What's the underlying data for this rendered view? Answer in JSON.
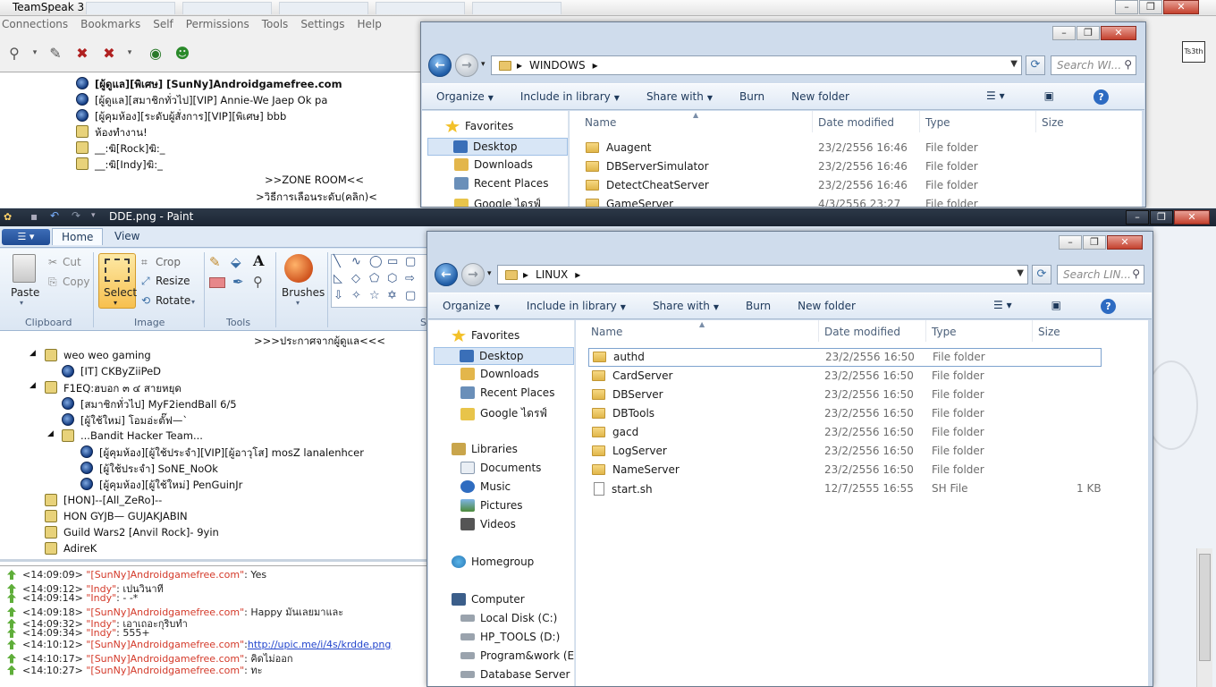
{
  "teamspeak": {
    "title": "TeamSpeak 3",
    "menu": [
      "Connections",
      "Bookmarks",
      "Self",
      "Permissions",
      "Tools",
      "Settings",
      "Help"
    ],
    "tree_top": [
      {
        "text": "[ผู้ดูแล][พิเศษ] [SunNy]Androidgamefree.com",
        "kind": "user",
        "bold": true
      },
      {
        "text": "[ผู้ดูแล][สมาชิกทั่วไป][VIP] Annie-We Jaep Ok pa",
        "kind": "user"
      },
      {
        "text": "[ผู้คุมห้อง][ระดับผู้สั่งการ][VIP][พิเศษ] bbb",
        "kind": "user"
      },
      {
        "text": "ห้องทำงาน!",
        "kind": "chan"
      },
      {
        "text": "__:ฆิ[Rock]ฆิ:_",
        "kind": "chan"
      },
      {
        "text": "__:ฆิ[Indy]ฆิ:_",
        "kind": "chan"
      }
    ],
    "zone_room": ">>ZONE ROOM<<",
    "choose_level": ">วิธีการเลือนระดับ(คลิก)<",
    "avatar_text": "Ts3th",
    "announcement": ">>>ประกาศจากผู้ดูแล<<<",
    "tree_bottom": [
      {
        "text": "weo weo gaming",
        "kind": "chan",
        "indent": 1
      },
      {
        "text": "[IT] CKByZiiPeD",
        "kind": "user",
        "indent": 2
      },
      {
        "text": "F1EQ:ฮบอก ๓ ๔ สายหยุด",
        "kind": "chan",
        "indent": 1
      },
      {
        "text": "[สมาชิกทั่วไป] MyF2iendBall 6/5",
        "kind": "user",
        "indent": 2
      },
      {
        "text": "[ผู้ใช้ใหม่] โอมอ่ะตั๊ฟ—`",
        "kind": "user",
        "indent": 2
      },
      {
        "text": "...Bandit Hacker Team...",
        "kind": "chan",
        "indent": 2
      },
      {
        "text": "[ผู้คุมห้อง][ผู้ใช้ประจำ][VIP][ผู้อาวุโส] mosZ lanalenhcer",
        "kind": "user",
        "indent": 3
      },
      {
        "text": "[ผู้ใช้ประจำ] SoNE_NoOk",
        "kind": "user",
        "indent": 3
      },
      {
        "text": "[ผู้คุมห้อง][ผู้ใช้ใหม่] PenGuinJr",
        "kind": "user",
        "indent": 3
      },
      {
        "text": "[HON]--[All_ZeRo]--",
        "kind": "chan",
        "indent": 1
      },
      {
        "text": "HON GYJB— GUJAKJABIN",
        "kind": "chan",
        "indent": 1
      },
      {
        "text": "Guild Wars2 [Anvil Rock]-  9yin",
        "kind": "chan",
        "indent": 1
      },
      {
        "text": "AdireK",
        "kind": "chan",
        "indent": 1
      }
    ],
    "log": [
      {
        "time": "<14:09:09>",
        "user": "\"[SunNy]Androidgamefree.com\"",
        "msg": ": Yes"
      },
      {
        "time": "<14:09:12>",
        "user": "\"Indy\"",
        "msg": ": เปนวินาที"
      },
      {
        "time": "<14:09:14>",
        "user": "\"Indy\"",
        "msg": ":  - -*"
      },
      {
        "time": "<14:09:18>",
        "user": "\"[SunNy]Androidgamefree.com\"",
        "msg": ": Happy  มันเลยมาและ"
      },
      {
        "time": "<14:09:32>",
        "user": "\"Indy\"",
        "msg": ": เอาเถอะกุริบทำ"
      },
      {
        "time": "<14:09:34>",
        "user": "\"Indy\"",
        "msg": ": 555+"
      },
      {
        "time": "<14:10:12>",
        "user": "\"[SunNy]Androidgamefree.com\"",
        "msg": ": ",
        "link": "http://upic.me/i/4s/krdde.png"
      },
      {
        "time": "<14:10:17>",
        "user": "\"[SunNy]Androidgamefree.com\"",
        "msg": ": คิดไม่ออก"
      },
      {
        "time": "<14:10:27>",
        "user": "\"[SunNy]Androidgamefree.com\"",
        "msg": ": ทะ"
      }
    ]
  },
  "paint": {
    "title": "DDE.png - Paint",
    "tabs": {
      "home": "Home",
      "view": "View"
    },
    "clipboard": {
      "paste": "Paste",
      "cut": "Cut",
      "copy": "Copy",
      "label": "Clipboard"
    },
    "image": {
      "select": "Select",
      "crop": "Crop",
      "resize": "Resize",
      "rotate": "Rotate",
      "label": "Image"
    },
    "tools_label": "Tools",
    "brushes": "Brushes",
    "shapes_label_clip": "S"
  },
  "explorer_windows": {
    "path": "WINDOWS",
    "search_placeholder": "Search WI...",
    "commands": [
      "Organize",
      "Include in library",
      "Share with",
      "Burn",
      "New folder"
    ],
    "columns": {
      "name": "Name",
      "date": "Date modified",
      "type": "Type",
      "size": "Size"
    },
    "nav": [
      {
        "label": "Favorites",
        "icon": "star-icon"
      },
      {
        "label": "Desktop",
        "icon": "desktop-icon",
        "selected": true
      },
      {
        "label": "Downloads",
        "icon": "downloads-icon"
      },
      {
        "label": "Recent Places",
        "icon": "recent-icon"
      },
      {
        "label": "Google ไดรฟ์",
        "icon": "drive-icon"
      }
    ],
    "files": [
      {
        "name": "Auagent",
        "date": "23/2/2556 16:46",
        "type": "File folder",
        "size": ""
      },
      {
        "name": "DBServerSimulator",
        "date": "23/2/2556 16:46",
        "type": "File folder",
        "size": ""
      },
      {
        "name": "DetectCheatServer",
        "date": "23/2/2556 16:46",
        "type": "File folder",
        "size": ""
      },
      {
        "name": "GameServer",
        "date": "4/3/2556 23:27",
        "type": "File folder",
        "size": ""
      }
    ]
  },
  "explorer_linux": {
    "path": "LINUX",
    "search_placeholder": "Search LIN...",
    "commands": [
      "Organize",
      "Include in library",
      "Share with",
      "Burn",
      "New folder"
    ],
    "columns": {
      "name": "Name",
      "date": "Date modified",
      "type": "Type",
      "size": "Size"
    },
    "nav": [
      {
        "label": "Favorites",
        "icon": "star-icon"
      },
      {
        "label": "Desktop",
        "icon": "desktop-icon",
        "selected": true
      },
      {
        "label": "Downloads",
        "icon": "downloads-icon"
      },
      {
        "label": "Recent Places",
        "icon": "recent-icon"
      },
      {
        "label": "Google ไดรฟ์",
        "icon": "drive-icon"
      },
      {
        "label": "Libraries",
        "icon": "libraries-icon"
      },
      {
        "label": "Documents",
        "icon": "documents-icon"
      },
      {
        "label": "Music",
        "icon": "music-icon"
      },
      {
        "label": "Pictures",
        "icon": "pictures-icon"
      },
      {
        "label": "Videos",
        "icon": "videos-icon"
      },
      {
        "label": "Homegroup",
        "icon": "homegroup-icon"
      },
      {
        "label": "Computer",
        "icon": "computer-icon"
      },
      {
        "label": "Local Disk (C:)",
        "icon": "disk-icon"
      },
      {
        "label": "HP_TOOLS (D:)",
        "icon": "disk-icon"
      },
      {
        "label": "Program&work (E:)",
        "icon": "disk-icon"
      },
      {
        "label": "Database Server all p",
        "icon": "disk-icon"
      }
    ],
    "files": [
      {
        "name": "authd",
        "date": "23/2/2556 16:50",
        "type": "File folder",
        "size": ""
      },
      {
        "name": "CardServer",
        "date": "23/2/2556 16:50",
        "type": "File folder",
        "size": ""
      },
      {
        "name": "DBServer",
        "date": "23/2/2556 16:50",
        "type": "File folder",
        "size": ""
      },
      {
        "name": "DBTools",
        "date": "23/2/2556 16:50",
        "type": "File folder",
        "size": ""
      },
      {
        "name": "gacd",
        "date": "23/2/2556 16:50",
        "type": "File folder",
        "size": ""
      },
      {
        "name": "LogServer",
        "date": "23/2/2556 16:50",
        "type": "File folder",
        "size": ""
      },
      {
        "name": "NameServer",
        "date": "23/2/2556 16:50",
        "type": "File folder",
        "size": ""
      },
      {
        "name": "start.sh",
        "date": "12/7/2555 16:55",
        "type": "SH File",
        "size": "1 KB"
      }
    ]
  }
}
